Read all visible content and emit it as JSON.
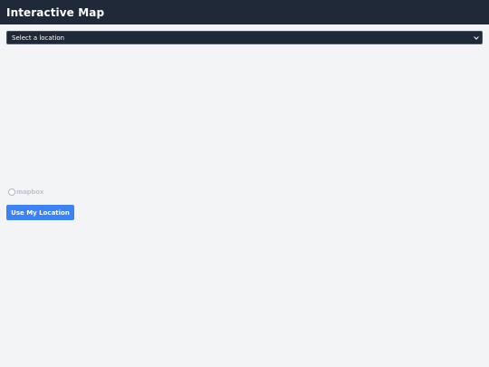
{
  "header": {
    "title": "Interactive Map"
  },
  "location_select": {
    "selected_value": "Select a location",
    "icon": "chevron-down-icon"
  },
  "map": {
    "attribution_logo_text": "mapbox",
    "logo_icon": "mapbox-logo-icon"
  },
  "actions": {
    "use_location_label": "Use My Location"
  },
  "colors": {
    "header_bg": "#1f2937",
    "page_bg": "#f3f4f6",
    "accent": "#3b82f6"
  }
}
